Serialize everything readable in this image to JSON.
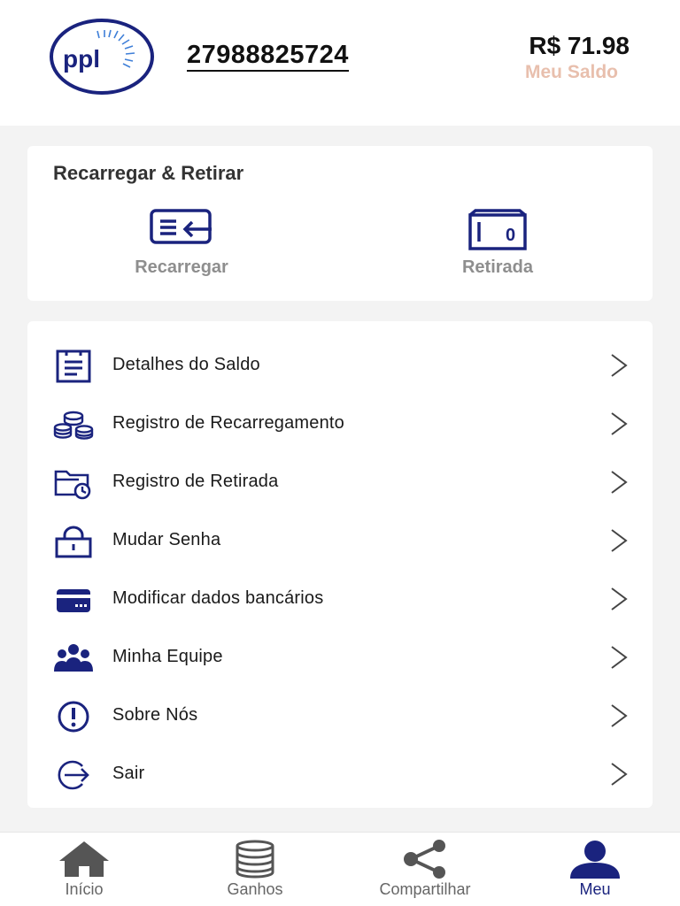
{
  "header": {
    "logo_text": "ppl",
    "phone": "27988825724",
    "balance": "R$ 71.98",
    "balance_label": "Meu Saldo"
  },
  "recharge_card": {
    "title": "Recarregar & Retirar",
    "actions": [
      {
        "label": "Recarregar",
        "icon": "card-transfer-icon"
      },
      {
        "label": "Retirada",
        "icon": "wallet-icon"
      }
    ]
  },
  "menu": {
    "items": [
      {
        "label": "Detalhes do Saldo",
        "icon": "document-icon"
      },
      {
        "label": "Registro de Recarregamento",
        "icon": "coins-icon"
      },
      {
        "label": "Registro de Retirada",
        "icon": "folder-clock-icon"
      },
      {
        "label": "Mudar Senha",
        "icon": "lock-icon"
      },
      {
        "label": "Modificar dados bancários",
        "icon": "bank-card-icon"
      },
      {
        "label": "Minha Equipe",
        "icon": "team-icon"
      },
      {
        "label": "Sobre Nós",
        "icon": "info-icon"
      },
      {
        "label": "Sair",
        "icon": "logout-icon"
      }
    ]
  },
  "bottom_nav": {
    "items": [
      {
        "label": "Início",
        "icon": "home-icon",
        "active": false
      },
      {
        "label": "Ganhos",
        "icon": "coins-stack-icon",
        "active": false
      },
      {
        "label": "Compartilhar",
        "icon": "share-icon",
        "active": false
      },
      {
        "label": "Meu",
        "icon": "user-icon",
        "active": true
      }
    ]
  },
  "colors": {
    "brand": "#1a237e",
    "balance_label": "#e8bfad",
    "nav_inactive": "#555555"
  }
}
